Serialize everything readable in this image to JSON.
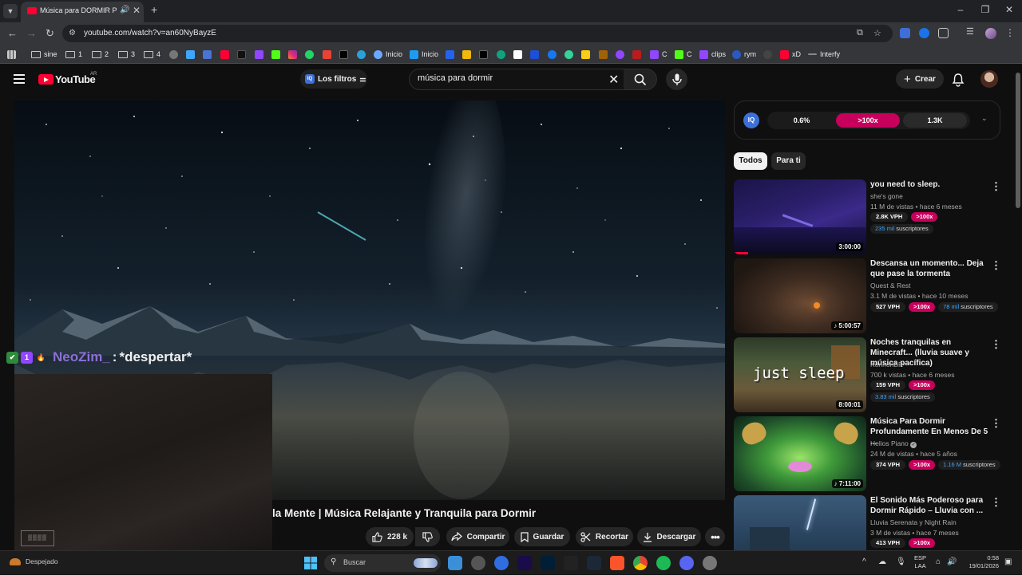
{
  "browser": {
    "tab": {
      "title": "Música para DORMIR PROF",
      "favicon": "youtube-icon",
      "audio_icon": "speaker-icon"
    },
    "address_bar": {
      "url": "youtube.com/watch?v=an60NyBayzE"
    },
    "bookmarks": [
      {
        "label": "sine",
        "type": "folder"
      },
      {
        "label": "1",
        "type": "folder"
      },
      {
        "label": "2",
        "type": "folder"
      },
      {
        "label": "3",
        "type": "folder"
      },
      {
        "label": "4",
        "type": "folder"
      },
      {
        "label": "Inicio",
        "type": "site"
      },
      {
        "label": "Inicio",
        "type": "site"
      },
      {
        "label": "C",
        "type": "site"
      },
      {
        "label": "C",
        "type": "site"
      },
      {
        "label": "clips",
        "type": "site"
      },
      {
        "label": "rym",
        "type": "site"
      },
      {
        "label": "xD",
        "type": "site"
      },
      {
        "label": "Interfy",
        "type": "site"
      }
    ]
  },
  "youtube": {
    "logo_text": "YouTube",
    "logo_country": "AR",
    "filters_label": "Los filtros",
    "search_value": "música para dormir",
    "create_label": "Crear",
    "colors": {
      "brand": "#ff0033",
      "accent_pink": "#c6005b",
      "link_blue": "#3ea6ff"
    }
  },
  "overlay": {
    "chat_badges": [
      "✔",
      "1",
      "🔥"
    ],
    "chat_user": "NeoZim_",
    "chat_separator": ":",
    "chat_message": "*despertar*"
  },
  "video": {
    "title_visible": "la Mente | Música Relajante y Tranquila para Dormir",
    "actions": {
      "likes": "228 k",
      "share": "Compartir",
      "save": "Guardar",
      "clip": "Recortar",
      "download": "Descargar"
    }
  },
  "iq_panel": {
    "stats": [
      "0.6%",
      ">100x",
      "1.3K"
    ]
  },
  "chips": [
    "Todos",
    "Para ti"
  ],
  "recommendations": [
    {
      "title": "you need to sleep.",
      "channel": "she's gone",
      "meta": "11 M de vistas • hace 6 meses",
      "vph": "2.8K VPH",
      "multiplier": ">100x",
      "subs_count": "235 mil",
      "subs_label": "suscriptores",
      "duration": "3:00:00"
    },
    {
      "title": "Descansa un momento... Deja que pase la tormenta",
      "channel": "Quest & Rest",
      "meta": "3.1 M de vistas • hace 10 meses",
      "vph": "527 VPH",
      "multiplier": ">100x",
      "subs_count": "78 mil",
      "subs_label": "suscriptores",
      "duration": "5:00:57"
    },
    {
      "title": "Noches tranquilas en Minecraft... (lluvia suave y música pacífica)",
      "channel": "KonnonBR",
      "meta": "700 k vistas • hace 6 meses",
      "vph": "159 VPH",
      "multiplier": ">100x",
      "subs_count": "3.83 mil",
      "subs_label": "suscriptores",
      "duration": "8:00:01",
      "thumb_text": "just sleep"
    },
    {
      "title": "Música Para Dormir Profundamente En Menos De 5 ...",
      "channel": "Helios Piano",
      "meta": "24 M de vistas • hace 5 años",
      "vph": "374 VPH",
      "multiplier": ">100x",
      "subs_count": "1.16 M",
      "subs_label": "suscriptores",
      "duration": "7:11:00"
    },
    {
      "title": "El Sonido Más Poderoso para Dormir Rápido – Lluvia con ...",
      "channel": "Lluvia Serenata y Night Rain",
      "meta": "3 M de vistas • hace 7 meses",
      "vph": "413 VPH",
      "multiplier": ">100x"
    }
  ],
  "taskbar": {
    "weather": "Despejado",
    "search_label": "Buscar",
    "lang_line1": "ESP",
    "lang_line2": "LAA",
    "time": "0:58",
    "date": "19/01/2026"
  }
}
